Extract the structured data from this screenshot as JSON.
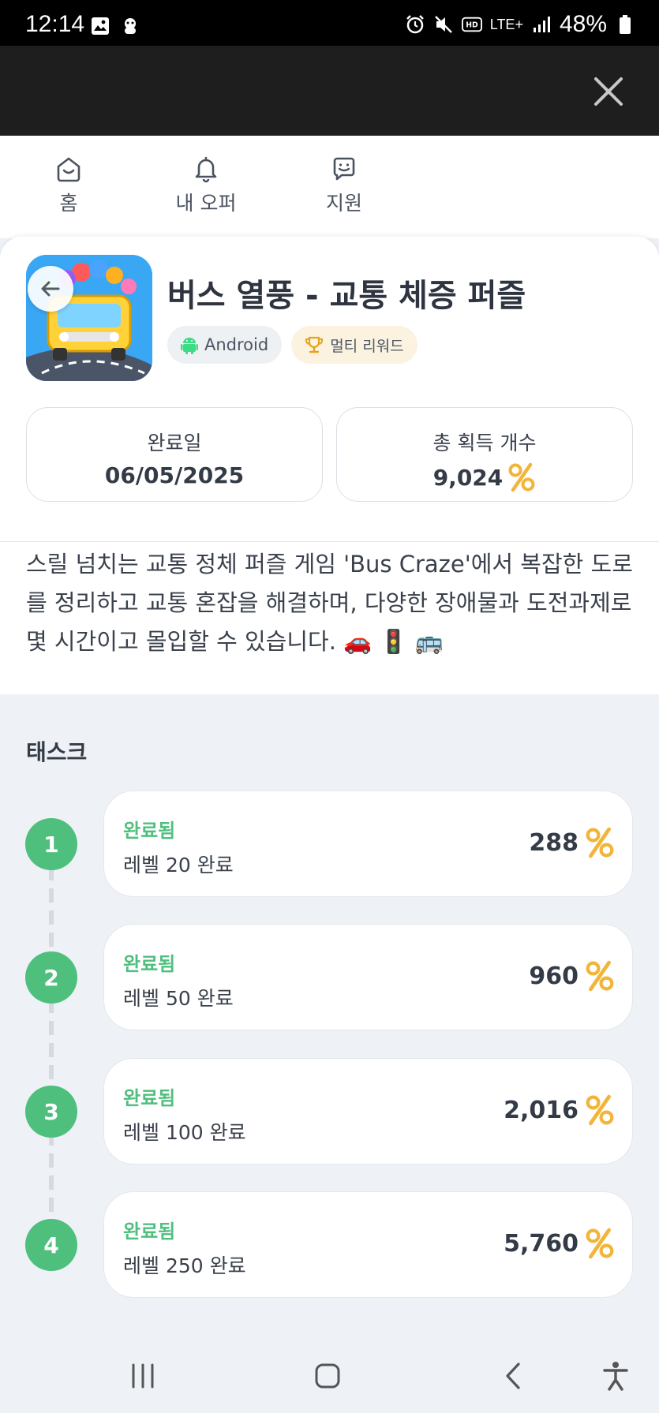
{
  "status_bar": {
    "time": "12:14",
    "battery": "48%",
    "network": "LTE+"
  },
  "nav": {
    "items": [
      {
        "label": "홈",
        "icon": "home-face-icon"
      },
      {
        "label": "내 오퍼",
        "icon": "bell-icon"
      },
      {
        "label": "지원",
        "icon": "support-chat-icon"
      }
    ]
  },
  "app": {
    "title": "버스 열풍 - 교통 체증 퍼즐",
    "tags": {
      "platform": "Android",
      "reward_type": "멀티 리워드"
    }
  },
  "stats": {
    "completed_label": "완료일",
    "completed_value": "06/05/2025",
    "total_label": "총 획득 개수",
    "total_value": "9,024"
  },
  "description": "스릴 넘치는 교통 정체 퍼즐 게임 'Bus Craze'에서 복잡한 도로를 정리하고 교통 혼잡을 해결하며, 다양한 장애물과 도전과제로 몇 시간이고 몰입할 수 있습니다. 🚗 🚦 🚌",
  "tasks": {
    "title": "태스크",
    "items": [
      {
        "step": "1",
        "status": "완료됨",
        "name": "레벨 20 완료",
        "reward": "288"
      },
      {
        "step": "2",
        "status": "완료됨",
        "name": "레벨 50 완료",
        "reward": "960"
      },
      {
        "step": "3",
        "status": "완료됨",
        "name": "레벨 100 완료",
        "reward": "2,016"
      },
      {
        "step": "4",
        "status": "완료됨",
        "name": "레벨 250 완료",
        "reward": "5,760"
      }
    ]
  },
  "colors": {
    "accent_green": "#4fbf7e",
    "coin_gold": "#f2b53a"
  }
}
